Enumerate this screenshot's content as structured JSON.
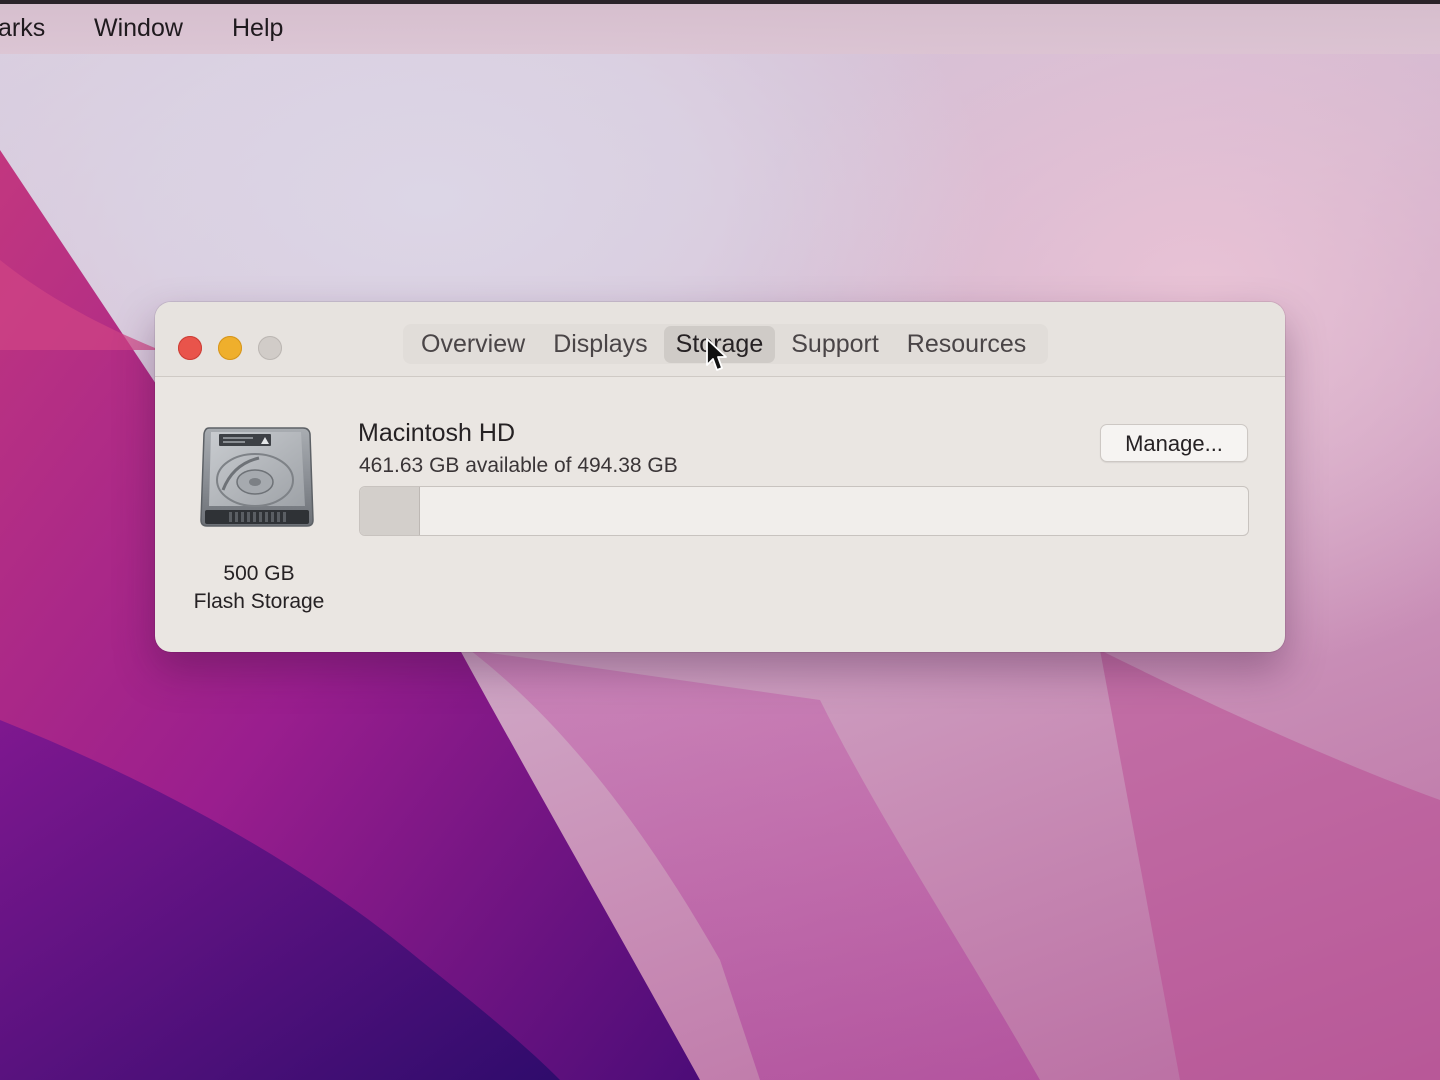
{
  "menubar": {
    "items": [
      "arks",
      "Window",
      "Help"
    ]
  },
  "window": {
    "tabs": [
      "Overview",
      "Displays",
      "Storage",
      "Support",
      "Resources"
    ],
    "active_tab": "Storage"
  },
  "drive": {
    "icon": "hard-drive-icon",
    "size": "500 GB",
    "type": "Flash Storage"
  },
  "volume": {
    "name": "Macintosh HD",
    "available_text": "461.63 GB available of 494.38 GB",
    "used_fraction": 0.066
  },
  "manage_button": {
    "label": "Manage..."
  },
  "colors": {
    "close": "#e9544b",
    "minimize": "#efaf2c",
    "zoom": "#d1ccc8"
  }
}
